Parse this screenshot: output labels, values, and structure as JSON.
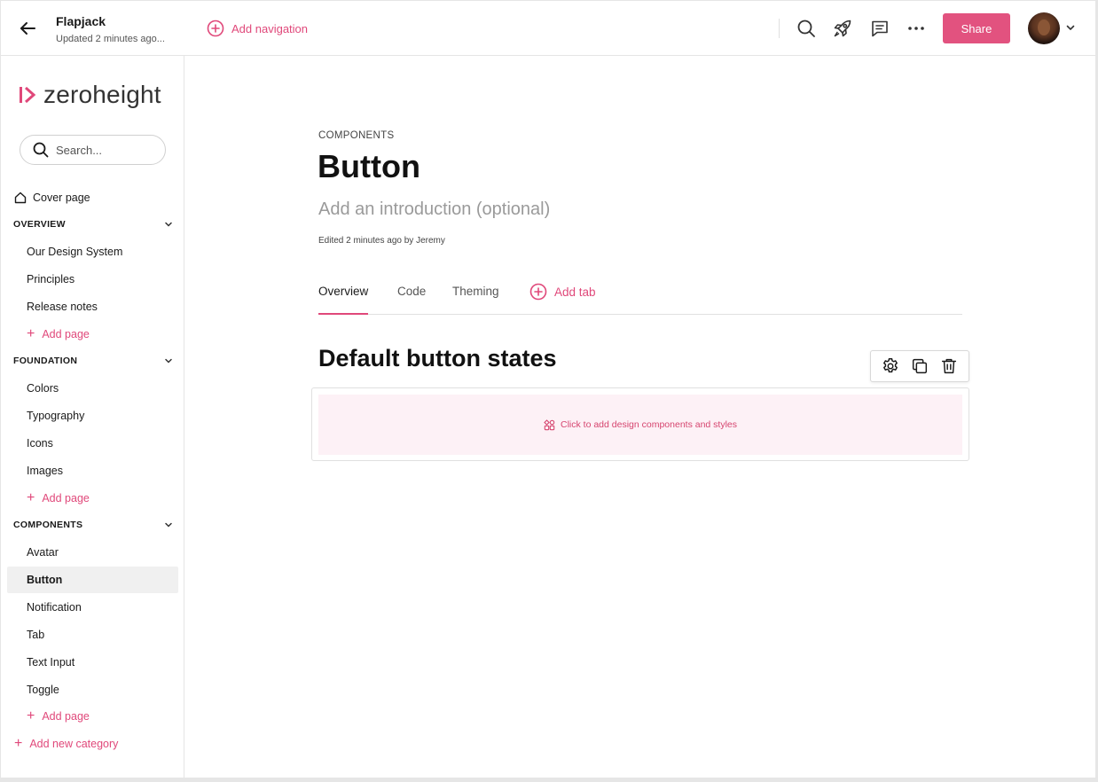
{
  "topbar": {
    "project_name": "Flapjack",
    "updated_text": "Updated 2 minutes ago...",
    "add_navigation_label": "Add navigation",
    "share_label": "Share"
  },
  "sidebar": {
    "brand": "zeroheight",
    "search_placeholder": "Search...",
    "cover_page": "Cover page",
    "sections": [
      {
        "title": "OVERVIEW",
        "items": [
          "Our Design System",
          "Principles",
          "Release notes"
        ],
        "add_label": "Add page"
      },
      {
        "title": "FOUNDATION",
        "items": [
          "Colors",
          "Typography",
          "Icons",
          "Images"
        ],
        "add_label": "Add page"
      },
      {
        "title": "COMPONENTS",
        "items": [
          "Avatar",
          "Button",
          "Notification",
          "Tab",
          "Text Input",
          "Toggle"
        ],
        "add_label": "Add page"
      }
    ],
    "active_item": "Button",
    "add_category_label": "Add new category"
  },
  "page": {
    "eyebrow": "COMPONENTS",
    "title": "Button",
    "intro_placeholder": "Add an introduction (optional)",
    "edited_text": "Edited 2 minutes ago by Jeremy",
    "tabs": [
      "Overview",
      "Code",
      "Theming"
    ],
    "add_tab_label": "Add tab",
    "section_title": "Default button states",
    "block_placeholder": "Click to add design components and styles"
  },
  "colors": {
    "accent": "#e0487a",
    "share_bg": "#e2527f",
    "block_bg": "#fdf1f6"
  }
}
